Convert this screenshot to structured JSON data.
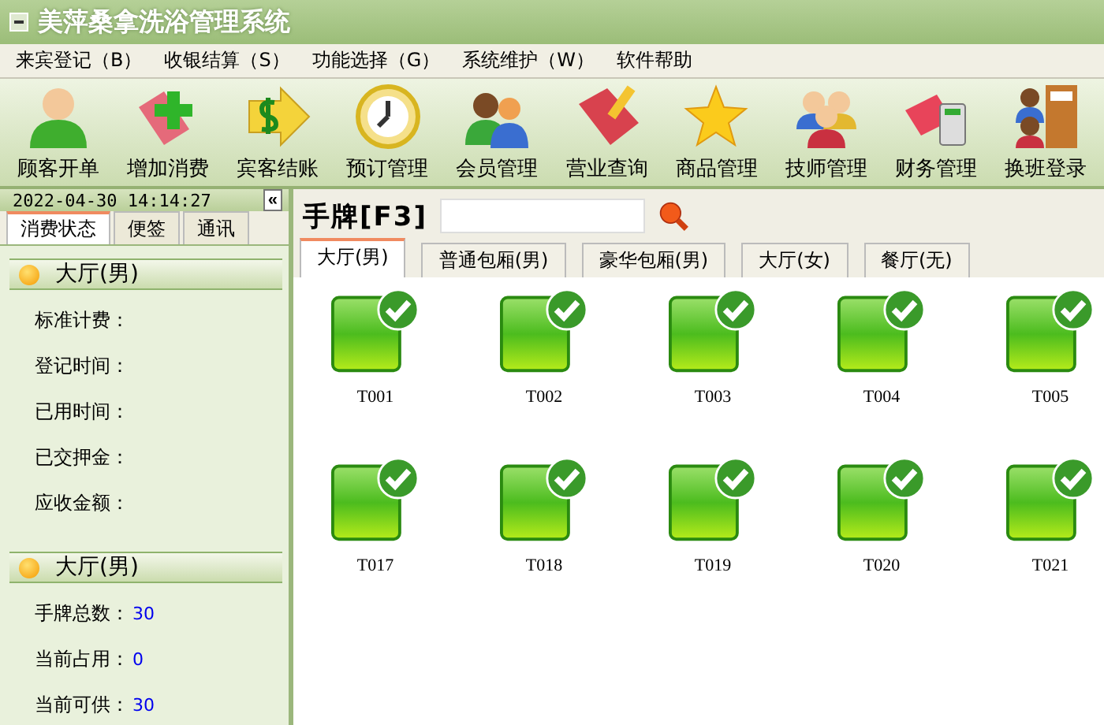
{
  "window": {
    "title": "美萍桑拿洗浴管理系统"
  },
  "menu": [
    "来宾登记（B）",
    "收银结算（S）",
    "功能选择（G）",
    "系统维护（W）",
    "软件帮助"
  ],
  "toolbar": [
    "顾客开单",
    "增加消费",
    "宾客结账",
    "预订管理",
    "会员管理",
    "营业查询",
    "商品管理",
    "技师管理",
    "财务管理",
    "换班登录"
  ],
  "sidebar": {
    "datetime": "2022-04-30 14:14:27",
    "collapse": "«",
    "tabs": [
      {
        "label": "消费状态",
        "selected": true
      },
      {
        "label": "便签",
        "selected": false
      },
      {
        "label": "通讯",
        "selected": false
      }
    ],
    "sections": [
      {
        "title": "大厅(男)",
        "fields": [
          {
            "label": "标准计费："
          },
          {
            "label": "登记时间："
          },
          {
            "label": "已用时间："
          },
          {
            "label": "已交押金："
          },
          {
            "label": "应收金额："
          }
        ]
      },
      {
        "title": "大厅(男)",
        "fields": [
          {
            "label": "手牌总数：",
            "value": "30"
          },
          {
            "label": "当前占用：",
            "value": "0"
          },
          {
            "label": "当前可供：",
            "value": "30"
          }
        ]
      }
    ]
  },
  "main": {
    "search_label": "手牌[F3]",
    "tabs": [
      {
        "label": "大厅(男)",
        "selected": true
      },
      {
        "label": "普通包厢(男)",
        "selected": false
      },
      {
        "label": "豪华包厢(男)",
        "selected": false
      },
      {
        "label": "大厅(女)",
        "selected": false
      },
      {
        "label": "餐厅(无)",
        "selected": false
      }
    ],
    "cards": [
      {
        "label": "T001"
      },
      {
        "label": "T002"
      },
      {
        "label": "T003"
      },
      {
        "label": "T004"
      },
      {
        "label": "T005"
      },
      {
        "label": "T017"
      },
      {
        "label": "T018"
      },
      {
        "label": "T019"
      },
      {
        "label": "T020"
      },
      {
        "label": "T021"
      }
    ]
  }
}
